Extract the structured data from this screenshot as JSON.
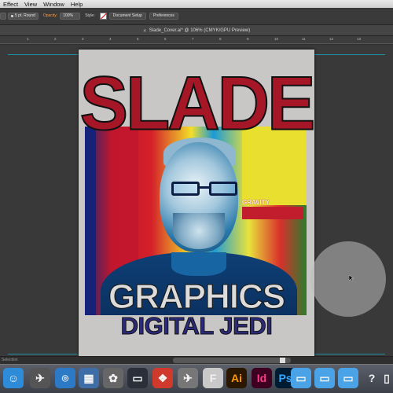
{
  "menu": {
    "items": [
      "Effect",
      "View",
      "Window",
      "Help"
    ]
  },
  "control_bar": {
    "stroke_size": "5 pt. Round",
    "opacity_label": "Opacity:",
    "opacity_value": "100%",
    "style_label": "Style:",
    "doc_setup": "Document Setup",
    "preferences": "Preferences"
  },
  "document_tab": {
    "title": "Slade_Cover.ai* @ 106% (CMYK/GPU Preview)",
    "close": "✕"
  },
  "ruler": {
    "numbers": [
      "1",
      "2",
      "3",
      "4",
      "5",
      "6",
      "7",
      "8",
      "9",
      "10",
      "11",
      "12",
      "13"
    ]
  },
  "artboard": {
    "title": "SLADE",
    "subtitle": "GRAPHICS",
    "tagline": "DIGITAL JEDI",
    "sign_text": "GRAVITY"
  },
  "scrollbar": {
    "left_text": "Selection"
  },
  "dock": {
    "items": [
      {
        "name": "finder-icon",
        "glyph": "☺",
        "color": "#2d8bd8"
      },
      {
        "name": "launchpad-icon",
        "glyph": "✈",
        "color": "#555"
      },
      {
        "name": "safari-icon",
        "glyph": "⌾",
        "color": "#2c79c6"
      },
      {
        "name": "preview-icon",
        "glyph": "▦",
        "color": "#3f6ea7"
      },
      {
        "name": "photos-icon",
        "glyph": "✿",
        "color": "#666"
      },
      {
        "name": "keynote-icon",
        "glyph": "▭",
        "color": "#2a2f3a"
      },
      {
        "name": "mosaic-icon",
        "glyph": "❖",
        "color": "#cf3a2d"
      },
      {
        "name": "plane-icon",
        "glyph": "✈",
        "color": "#777"
      },
      {
        "name": "fonts-icon",
        "glyph": "F",
        "color": "#c9c9c9"
      },
      {
        "name": "illustrator-icon",
        "glyph": "Ai",
        "color": "#2b1600"
      },
      {
        "name": "indesign-icon",
        "glyph": "Id",
        "color": "#3d0020"
      },
      {
        "name": "photoshop-icon",
        "glyph": "Ps",
        "color": "#001c33"
      },
      {
        "name": "folder-icon",
        "glyph": "▭",
        "color": "#4aa3e6"
      },
      {
        "name": "downloads-icon",
        "glyph": "▭",
        "color": "#4aa3e6"
      },
      {
        "name": "screenshots-icon",
        "glyph": "▭",
        "color": "#4aa3e6"
      },
      {
        "name": "help-icon",
        "glyph": "?",
        "color": "#888"
      },
      {
        "name": "trash-icon",
        "glyph": "▯",
        "color": "#888"
      }
    ]
  },
  "colors": {
    "accent": "#ff9a3a",
    "slade_red": "#a51627",
    "jedi_blue": "#2c2a7a",
    "guide": "#1e8fa0"
  }
}
